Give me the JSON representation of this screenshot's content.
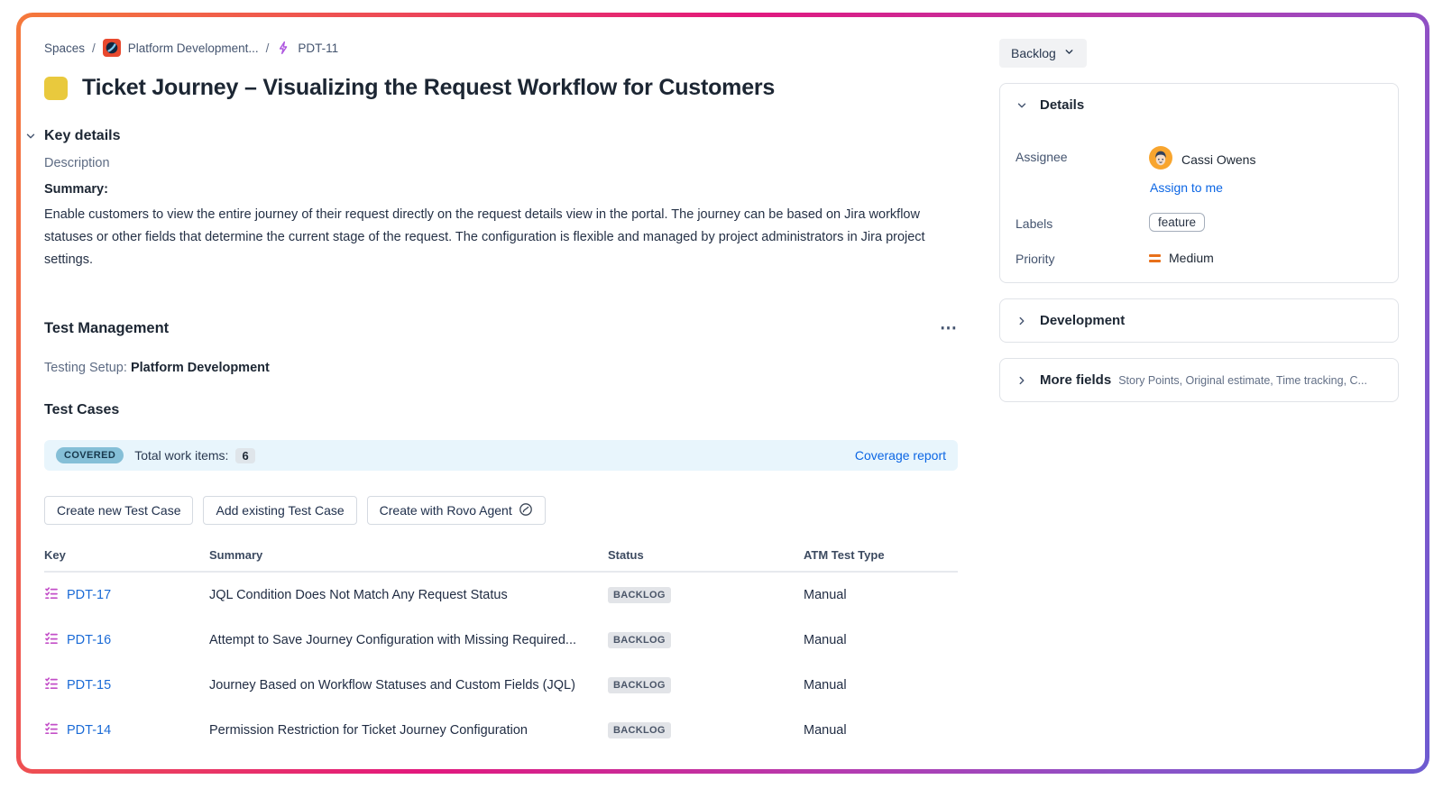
{
  "breadcrumb": {
    "spaces": "Spaces",
    "separator": "/",
    "project": "Platform Development...",
    "issue": "PDT-11"
  },
  "header": {
    "title": "Ticket Journey – Visualizing the Request Workflow for Customers",
    "status_button": "Backlog"
  },
  "key_details": {
    "heading": "Key details",
    "description_label": "Description",
    "summary_label": "Summary:",
    "summary_text": "Enable customers to view the entire journey of their request directly on the request details view in the portal. The journey can be based on Jira workflow statuses or other fields that determine the current stage of the request. The configuration is flexible and managed by project administrators in Jira project settings."
  },
  "test_management": {
    "heading": "Test Management",
    "more_menu": "⋯",
    "testing_setup_label": "Testing Setup:",
    "testing_setup_value": "Platform Development",
    "test_cases_heading": "Test Cases",
    "coverage": {
      "badge": "COVERED",
      "total_label": "Total work items:",
      "total_value": "6",
      "report_link": "Coverage report"
    },
    "buttons": {
      "create_new": "Create new Test Case",
      "add_existing": "Add existing Test Case",
      "create_rovo": "Create with Rovo Agent"
    }
  },
  "test_cases_table": {
    "columns": {
      "key": "Key",
      "summary": "Summary",
      "status": "Status",
      "type": "ATM Test Type"
    },
    "rows": [
      {
        "key": "PDT-17",
        "summary": "JQL Condition Does Not Match Any Request Status",
        "status": "BACKLOG",
        "type": "Manual"
      },
      {
        "key": "PDT-16",
        "summary": "Attempt to Save Journey Configuration with Missing Required...",
        "status": "BACKLOG",
        "type": "Manual"
      },
      {
        "key": "PDT-15",
        "summary": "Journey Based on Workflow Statuses and Custom Fields (JQL)",
        "status": "BACKLOG",
        "type": "Manual"
      },
      {
        "key": "PDT-14",
        "summary": "Permission Restriction for Ticket Journey Configuration",
        "status": "BACKLOG",
        "type": "Manual"
      }
    ]
  },
  "details_panel": {
    "heading": "Details",
    "assignee_label": "Assignee",
    "assignee_name": "Cassi Owens",
    "assign_to_me": "Assign to me",
    "labels_label": "Labels",
    "label_value": "feature",
    "priority_label": "Priority",
    "priority_value": "Medium"
  },
  "development_panel": {
    "heading": "Development"
  },
  "more_fields_panel": {
    "heading": "More fields",
    "subtitle": "Story Points, Original estimate, Time tracking, C..."
  },
  "colors": {
    "frame_gradient_start": "#f5793b",
    "frame_gradient_mid": "#e2187d",
    "frame_gradient_end": "#6d5bd0",
    "issue_type_yellow": "#e9c93d",
    "covered_badge_bg": "#85bfd7",
    "backlog_badge_bg": "#e2e4e8",
    "link_blue": "#0c66e4",
    "priority_medium_orange": "#e8701a",
    "test_case_icon_magenta": "#c34fc8"
  }
}
